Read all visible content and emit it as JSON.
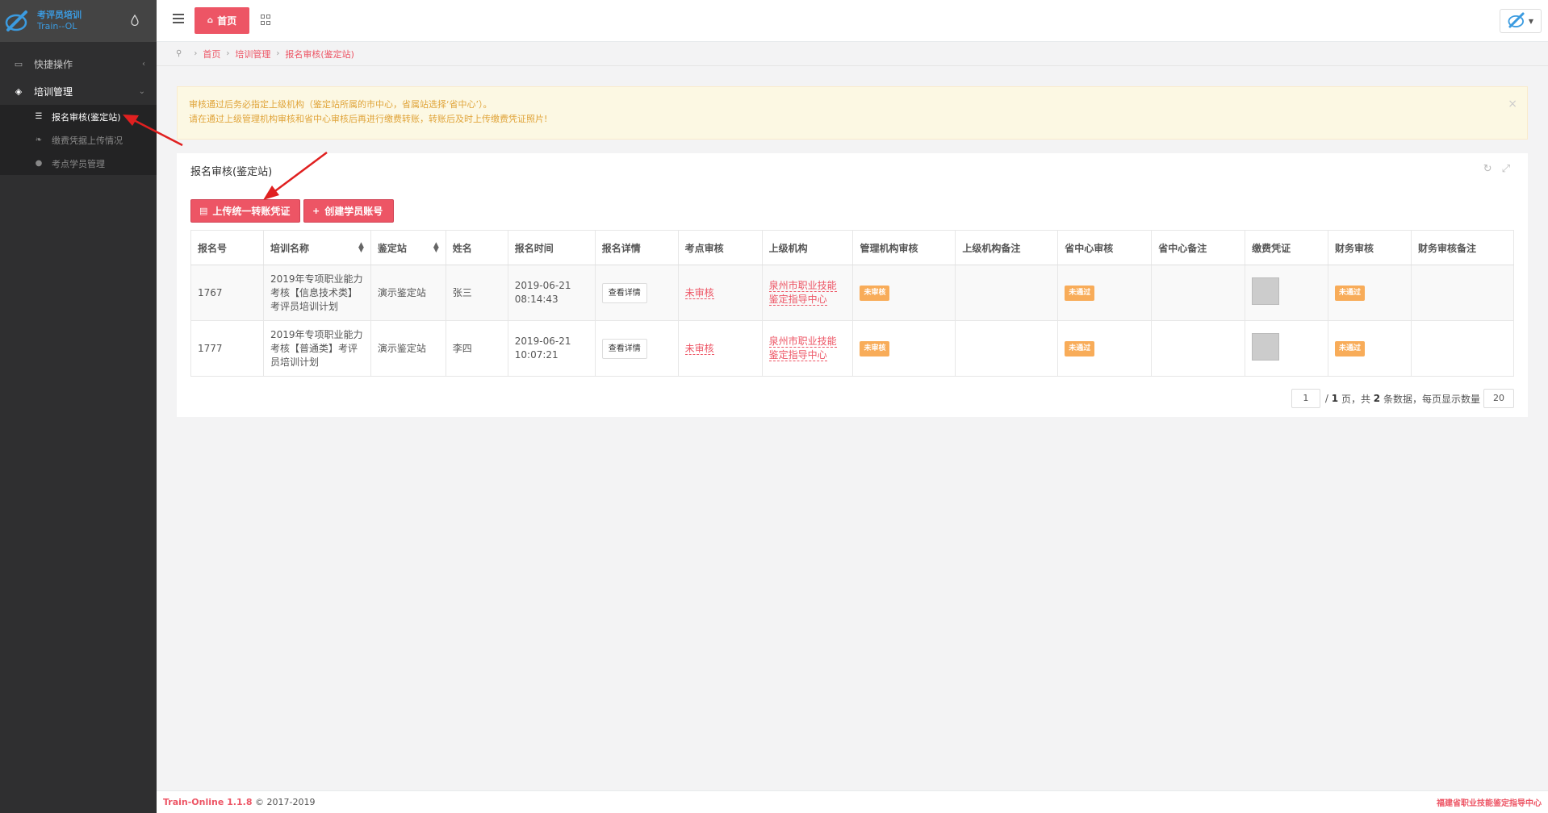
{
  "sidebar": {
    "logo_line1": "考评员培训",
    "logo_line2": "Train--OL",
    "items": [
      {
        "label": "快捷操作"
      },
      {
        "label": "培训管理"
      }
    ],
    "subitems": [
      {
        "label": "报名审核(鉴定站)"
      },
      {
        "label": "缴费凭据上传情况"
      },
      {
        "label": "考点学员管理"
      }
    ]
  },
  "topbar": {
    "home_tab": "首页"
  },
  "breadcrumb": {
    "items": [
      "首页",
      "培训管理",
      "报名审核(鉴定站)"
    ]
  },
  "alert": {
    "line1": "审核通过后务必指定上级机构（鉴定站所属的市中心，省属站选择‘省中心’）。",
    "line2": "请在通过上级管理机构审核和省中心审核后再进行缴费转账，转账后及时上传缴费凭证照片!",
    "close": "×"
  },
  "panel": {
    "title": "报名审核(鉴定站)",
    "upload_button": "上传统一转账凭证",
    "create_button": "创建学员账号"
  },
  "table": {
    "headers": [
      "报名号",
      "培训名称",
      "鉴定站",
      "姓名",
      "报名时间",
      "报名详情",
      "考点审核",
      "上级机构",
      "管理机构审核",
      "上级机构备注",
      "省中心审核",
      "省中心备注",
      "缴费凭证",
      "财务审核",
      "财务审核备注"
    ],
    "rows": [
      {
        "id": "1767",
        "name": "2019年专项职业能力考核【信息技术类】考评员培训计划",
        "station": "演示鉴定站",
        "person": "张三",
        "date": "2019-06-21",
        "time": "08:14:43",
        "detail": "查看详情",
        "site_review": "未审核",
        "superior": "泉州市职业技能鉴定指导中心",
        "mgmt_review": "未审核",
        "mgmt_note": "",
        "prov_review": "未通过",
        "prov_note": "",
        "finance_review": "未通过",
        "finance_note": ""
      },
      {
        "id": "1777",
        "name": "2019年专项职业能力考核【普通类】考评员培训计划",
        "station": "演示鉴定站",
        "person": "李四",
        "date": "2019-06-21",
        "time": "10:07:21",
        "detail": "查看详情",
        "site_review": "未审核",
        "superior": "泉州市职业技能鉴定指导中心",
        "mgmt_review": "未审核",
        "mgmt_note": "",
        "prov_review": "未通过",
        "prov_note": "",
        "finance_review": "未通过",
        "finance_note": ""
      }
    ]
  },
  "pager": {
    "current_page": "1",
    "sep": "/",
    "total_pages": "1",
    "page_unit": "页，共",
    "total_records": "2",
    "records_unit": "条数据，每页显示数量",
    "page_size": "20"
  },
  "footer": {
    "brand": "Train-Online 1.1.8",
    "copyright": "© 2017-2019",
    "org": "福建省职业技能鉴定指导中心"
  },
  "colors": {
    "accent": "#ed5565",
    "warning": "#f8ac59",
    "sidebar_bg": "#2f2f30"
  }
}
